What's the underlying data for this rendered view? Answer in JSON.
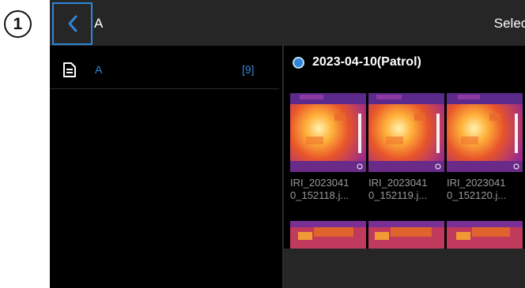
{
  "callout": {
    "number": "1"
  },
  "header": {
    "title": "A",
    "select_label": "Select"
  },
  "folders": [
    {
      "name": "A",
      "count": "[9]"
    }
  ],
  "group": {
    "title": "2023-04-10(Patrol)"
  },
  "thumbnails": [
    {
      "label": "IRI_2023041\n0_152118.j..."
    },
    {
      "label": "IRI_2023041\n0_152119.j..."
    },
    {
      "label": "IRI_2023041\n0_152120.j..."
    }
  ],
  "colors": {
    "accent": "#2f86d8",
    "topbar": "#262626",
    "background": "#000000"
  },
  "icons": [
    "back-chevron-icon",
    "document-icon",
    "radio-selected-icon"
  ]
}
